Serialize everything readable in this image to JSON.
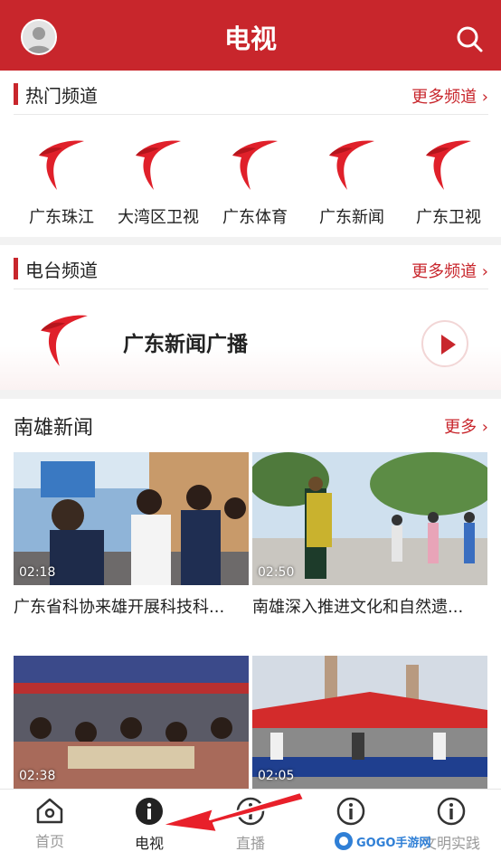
{
  "header": {
    "title": "电视",
    "avatar_icon": "default-avatar",
    "search_icon": "search-icon",
    "color": "#c8262c"
  },
  "hot_channels": {
    "title": "热门频道",
    "more": "更多频道 ›",
    "items": [
      {
        "label": "广东珠江"
      },
      {
        "label": "大湾区卫视"
      },
      {
        "label": "广东体育"
      },
      {
        "label": "广东新闻"
      },
      {
        "label": "广东卫视"
      }
    ]
  },
  "radio_channels": {
    "title": "电台频道",
    "more": "更多频道 ›",
    "item": {
      "label": "广东新闻广播"
    }
  },
  "nanxiong_news": {
    "title": "南雄新闻",
    "more": "更多 ›",
    "videos": [
      {
        "duration": "02:18",
        "title": "广东省科协来雄开展科技科..."
      },
      {
        "duration": "02:50",
        "title": "南雄深入推进文化和自然遗..."
      },
      {
        "duration": "02:38",
        "title": ""
      },
      {
        "duration": "02:05",
        "title": ""
      }
    ]
  },
  "tabs": [
    {
      "label": "首页",
      "icon": "home-icon"
    },
    {
      "label": "电视",
      "icon": "info-icon",
      "active": true
    },
    {
      "label": "直播",
      "icon": "info-icon"
    },
    {
      "label": "",
      "icon": "info-icon"
    },
    {
      "label": "文明实践",
      "icon": "info-icon"
    }
  ],
  "watermark": "GOGO手游网"
}
